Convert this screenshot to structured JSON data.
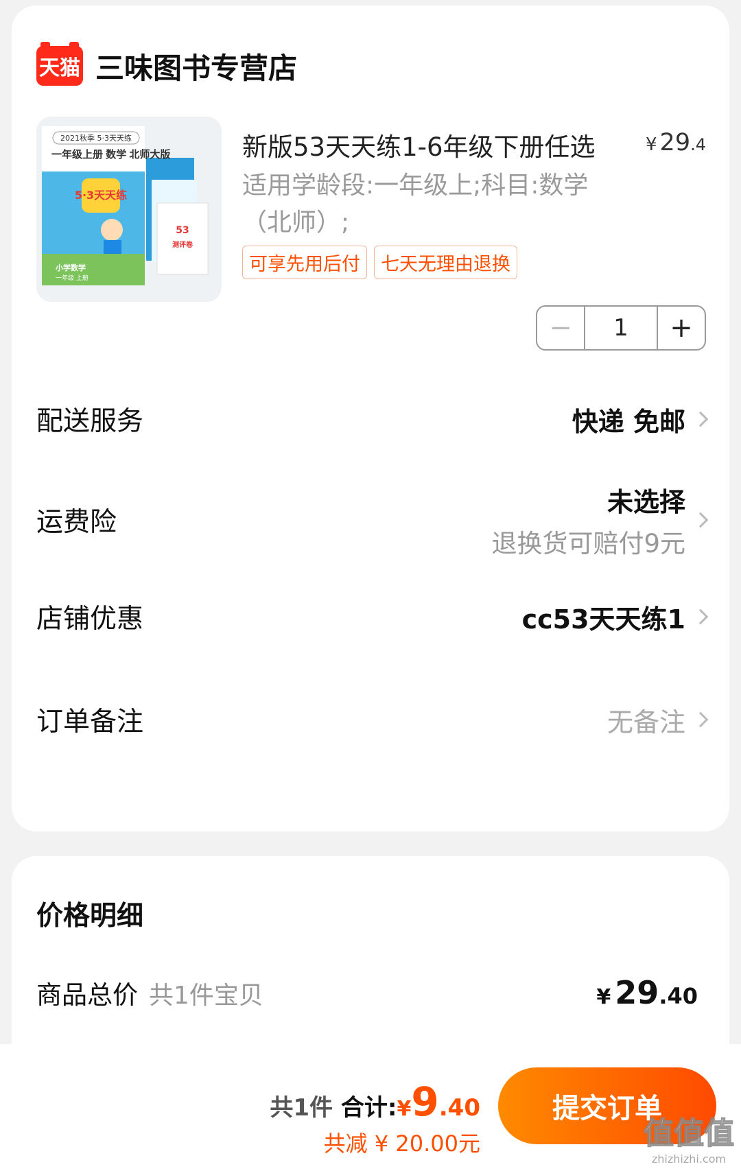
{
  "store": {
    "logo_text": "天猫",
    "name": "三味图书专营店"
  },
  "product": {
    "title": "新版53天天练1-6年级下册任选",
    "price_symbol": "¥",
    "price_int": "29",
    "price_dec": ".4",
    "spec": "适用学龄段:一年级上;科目:数学（北师）;",
    "tags": [
      "可享先用后付",
      "七天无理由退换"
    ],
    "quantity": "1",
    "image": {
      "cover_top": "2021秋季 5·3天天练",
      "cover_title": "一年级上册 数学 北师大版",
      "logo": "5·3天天练",
      "subject": "小学数学",
      "grade": "一年级 上册",
      "side_book": "测评卷"
    }
  },
  "rows": {
    "delivery": {
      "label": "配送服务",
      "value": "快递 免邮"
    },
    "insurance": {
      "label": "运费险",
      "value": "未选择",
      "sub": "退换货可赔付9元"
    },
    "coupon": {
      "label": "店铺优惠",
      "value": "cc53天天练1"
    },
    "remark": {
      "label": "订单备注",
      "value": "无备注"
    }
  },
  "price_detail": {
    "title": "价格明细",
    "total_label": "商品总价",
    "total_note": "共1件宝贝",
    "total_symbol": "¥",
    "total_int": "29",
    "total_dec": ".40"
  },
  "bottom": {
    "count": "共1件",
    "sum_label": "合计:",
    "pay_symbol": "¥",
    "pay_int": "9",
    "pay_dec": ".40",
    "saved": "共减 ¥ 20.00元",
    "submit": "提交订单"
  },
  "watermark": {
    "main": "值值值",
    "site": "zhizhizhi.com"
  },
  "colors": {
    "accent": "#ff5000",
    "tmall_red": "#ff2a1a"
  }
}
